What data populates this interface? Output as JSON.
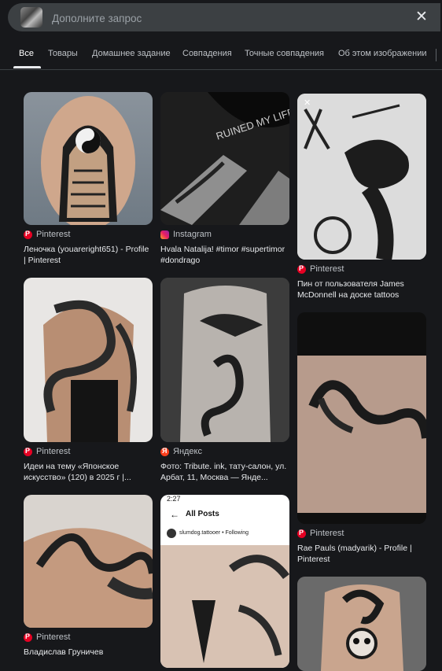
{
  "search": {
    "placeholder": "Дополните запрос",
    "clear_icon": "close-icon"
  },
  "tabs": [
    {
      "label": "Все",
      "active": true
    },
    {
      "label": "Товары"
    },
    {
      "label": "Домашнее задание"
    },
    {
      "label": "Совпадения"
    },
    {
      "label": "Точные совпадения"
    },
    {
      "label": "Об этом изображении"
    }
  ],
  "results": [
    {
      "source": "Pinterest",
      "icon": "pinterest-icon",
      "title": "Леночка (youareright651) - Profile | Pinterest"
    },
    {
      "source": "Instagram",
      "icon": "instagram-icon",
      "title": "Hvala Natalija! #timor #supertimor #dondrago"
    },
    {
      "source": "Pinterest",
      "icon": "pinterest-icon",
      "title": "Пин от пользователя James McDonnell на доске tattoos"
    },
    {
      "source": "Pinterest",
      "icon": "pinterest-icon",
      "title": "Идеи на тему «Японское искусство» (120) в 2025 г |..."
    },
    {
      "source": "Яндекс",
      "icon": "yandex-icon",
      "title": "Фото: Tribute. ink, тату-салон, ул. Арбат, 11, Москва — Янде..."
    },
    {
      "source": "Pinterest",
      "icon": "pinterest-icon",
      "title": "Rae Pauls (madyarik) - Profile | Pinterest"
    },
    {
      "source": "Pinterest",
      "icon": "pinterest-icon",
      "title": "Владислав Груничев"
    }
  ],
  "image_texts": {
    "shirt_text": "RUINED MY LIFE",
    "phone_header": "All Posts",
    "phone_status": "2:27",
    "phone_user": "slumdog.tattooer • Following"
  }
}
